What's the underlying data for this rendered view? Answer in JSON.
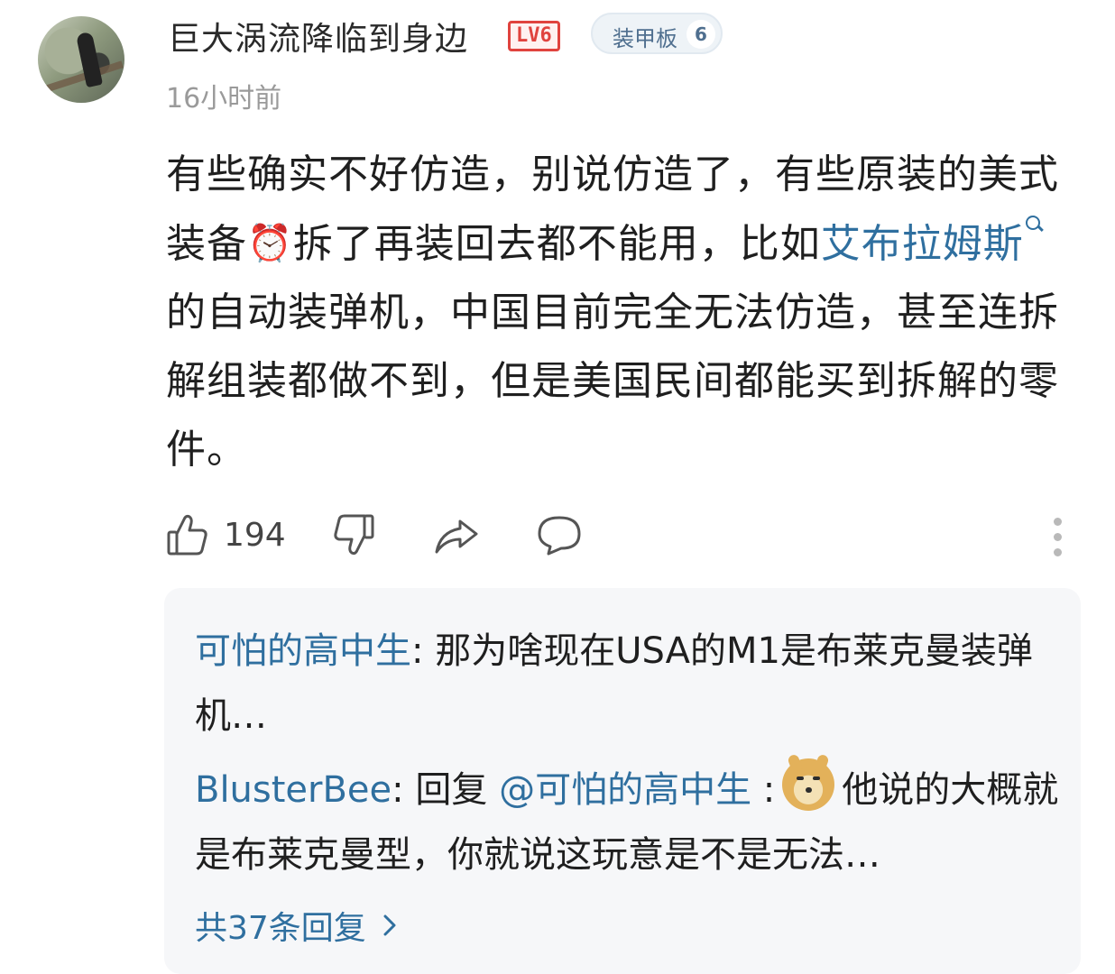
{
  "comment": {
    "username": "巨大涡流降临到身边",
    "level_badge": "LV6",
    "fan_badge": {
      "label": "装甲板",
      "count": "6"
    },
    "timestamp": "16小时前",
    "text_parts": {
      "p1": "有些确实不好仿造，别说仿造了，有些原装的美式装备",
      "p2": "拆了再装回去都不能用，比如",
      "link": "艾布拉姆斯",
      "p3": "的自动装弹机，中国目前完全无法仿造，甚至连拆解组装都做不到，但是美国民间都能买到拆解的零件。"
    },
    "alarm_emoji": "⏰",
    "actions": {
      "like_count": "194"
    }
  },
  "replies": {
    "items": [
      {
        "user": "可怕的高中生",
        "sep": ": ",
        "text": "那为啥现在USA的M1是布莱克曼装弹机…"
      },
      {
        "user": "BlusterBee",
        "sep": ": ",
        "reply_prefix": "回复 ",
        "mention": "@可怕的高中生",
        "mention_sep": " :",
        "text": "他说的大概就是布莱克曼型，你就说这玩意是不是无法…"
      }
    ],
    "view_all": "共37条回复"
  },
  "colors": {
    "link": "#2f6f9f",
    "level_badge": "#e0433e",
    "reply_bg": "#f6f7f9"
  }
}
